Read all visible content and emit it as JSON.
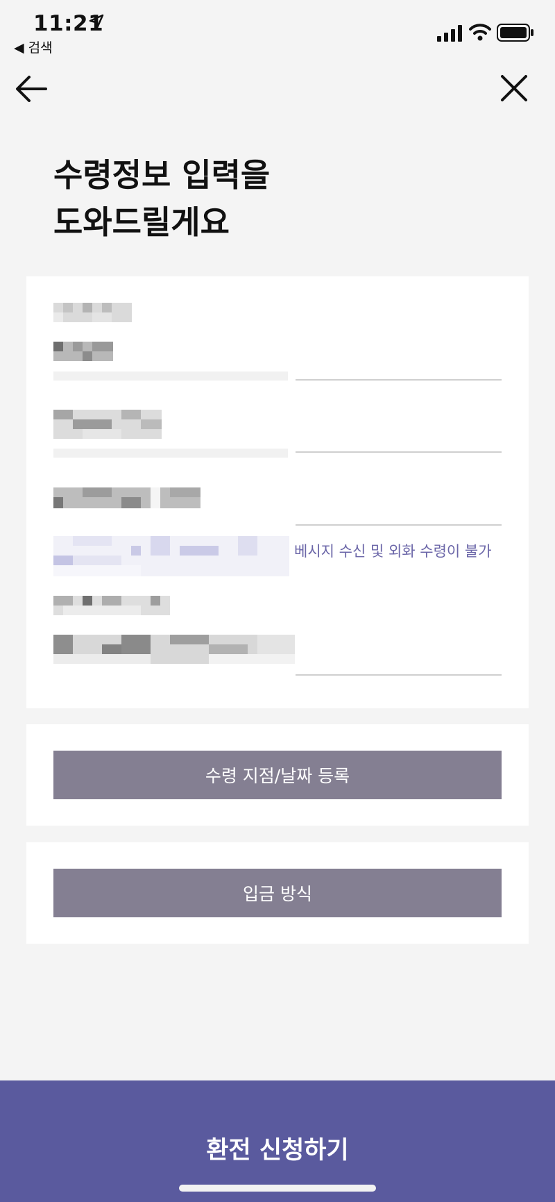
{
  "status_bar": {
    "time": "11:21",
    "back_app_label": "◀ 검색",
    "signal_icon": "cellular-signal-icon",
    "wifi_icon": "wifi-icon",
    "battery_icon": "battery-icon"
  },
  "nav": {
    "back_icon": "arrow-left-icon",
    "close_icon": "close-icon"
  },
  "heading": {
    "line1": "수령정보 입력을",
    "line2": "도와드릴게요"
  },
  "form": {
    "notice_text": "베시지 수신 및 외화 수령이 불가"
  },
  "buttons": {
    "branch_date": "수령 지점/날짜 등록",
    "deposit_method": "입금 방식"
  },
  "cta": {
    "label": "환전 신청하기"
  },
  "colors": {
    "background": "#f4f4f4",
    "card": "#ffffff",
    "grey_button": "#847f92",
    "primary": "#5a5a9e",
    "notice_text": "#6b66a8"
  }
}
